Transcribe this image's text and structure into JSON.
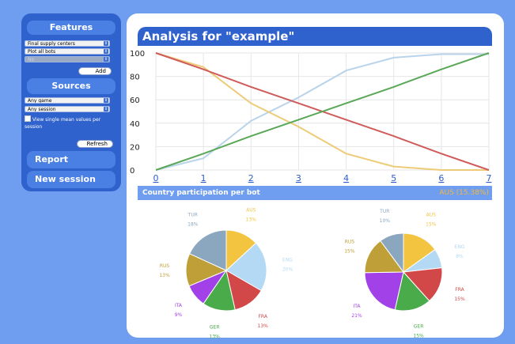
{
  "sidebar": {
    "features_title": "Features",
    "select_feature": "Final supply centers",
    "select_bots": "Plot all bots",
    "select_disabled": "No",
    "add_label": "Add",
    "sources_title": "Sources",
    "select_game": "Any game",
    "select_session": "Any session",
    "checkbox_label": "View single mean values per session",
    "refresh_label": "Refresh",
    "report_label": "Report",
    "new_session_label": "New session"
  },
  "main": {
    "title": "Analysis for \"example\"",
    "participation_title": "Country participation per bot",
    "participation_highlight": "AUS (15.38%)",
    "highlight_color": "#f5b836"
  },
  "chart_data": [
    {
      "type": "line",
      "title": "",
      "xlabel": "",
      "ylabel": "",
      "x": [
        0,
        1,
        2,
        3,
        4,
        5,
        6,
        7
      ],
      "ylim": [
        0,
        100
      ],
      "yticks": [
        0,
        20,
        40,
        60,
        80,
        100
      ],
      "grid": true,
      "series": [
        {
          "color": "#b9d4ea",
          "values": [
            0,
            10,
            42,
            62,
            85,
            96,
            99,
            99
          ]
        },
        {
          "color": "#eecb78",
          "values": [
            100,
            88,
            57,
            37,
            14,
            3,
            0,
            0
          ]
        },
        {
          "color": "#cf5b5b",
          "values": [
            100,
            86,
            71,
            57,
            43,
            29,
            14,
            0
          ]
        },
        {
          "color": "#5aa857",
          "values": [
            0,
            14,
            29,
            43,
            57,
            71,
            86,
            100
          ]
        }
      ]
    },
    {
      "type": "pie",
      "slices": [
        {
          "label": "AUS",
          "pct": "13%",
          "value": 13,
          "color": "#f2c440"
        },
        {
          "label": "ENG",
          "pct": "20%",
          "value": 20,
          "color": "#b3d9f5"
        },
        {
          "label": "FRA",
          "pct": "13%",
          "value": 13,
          "color": "#d24848"
        },
        {
          "label": "GER",
          "pct": "13%",
          "value": 13,
          "color": "#4aab4a"
        },
        {
          "label": "ITA",
          "pct": "9%",
          "value": 9,
          "color": "#a341e8"
        },
        {
          "label": "RUS",
          "pct": "13%",
          "value": 13,
          "color": "#bfa038"
        },
        {
          "label": "TUR",
          "pct": "18%",
          "value": 18,
          "color": "#8ba7bf"
        }
      ]
    },
    {
      "type": "pie",
      "slices": [
        {
          "label": "AUS",
          "pct": "15%",
          "value": 15,
          "color": "#f2c440"
        },
        {
          "label": "ENG",
          "pct": "8%",
          "value": 8,
          "color": "#b3d9f5"
        },
        {
          "label": "FRA",
          "pct": "15%",
          "value": 15,
          "color": "#d24848"
        },
        {
          "label": "GER",
          "pct": "15%",
          "value": 15,
          "color": "#4aab4a"
        },
        {
          "label": "ITA",
          "pct": "21%",
          "value": 21,
          "color": "#a341e8"
        },
        {
          "label": "RUS",
          "pct": "15%",
          "value": 15,
          "color": "#bfa038"
        },
        {
          "label": "TUR",
          "pct": "10%",
          "value": 10,
          "color": "#8ba7bf"
        }
      ]
    }
  ]
}
